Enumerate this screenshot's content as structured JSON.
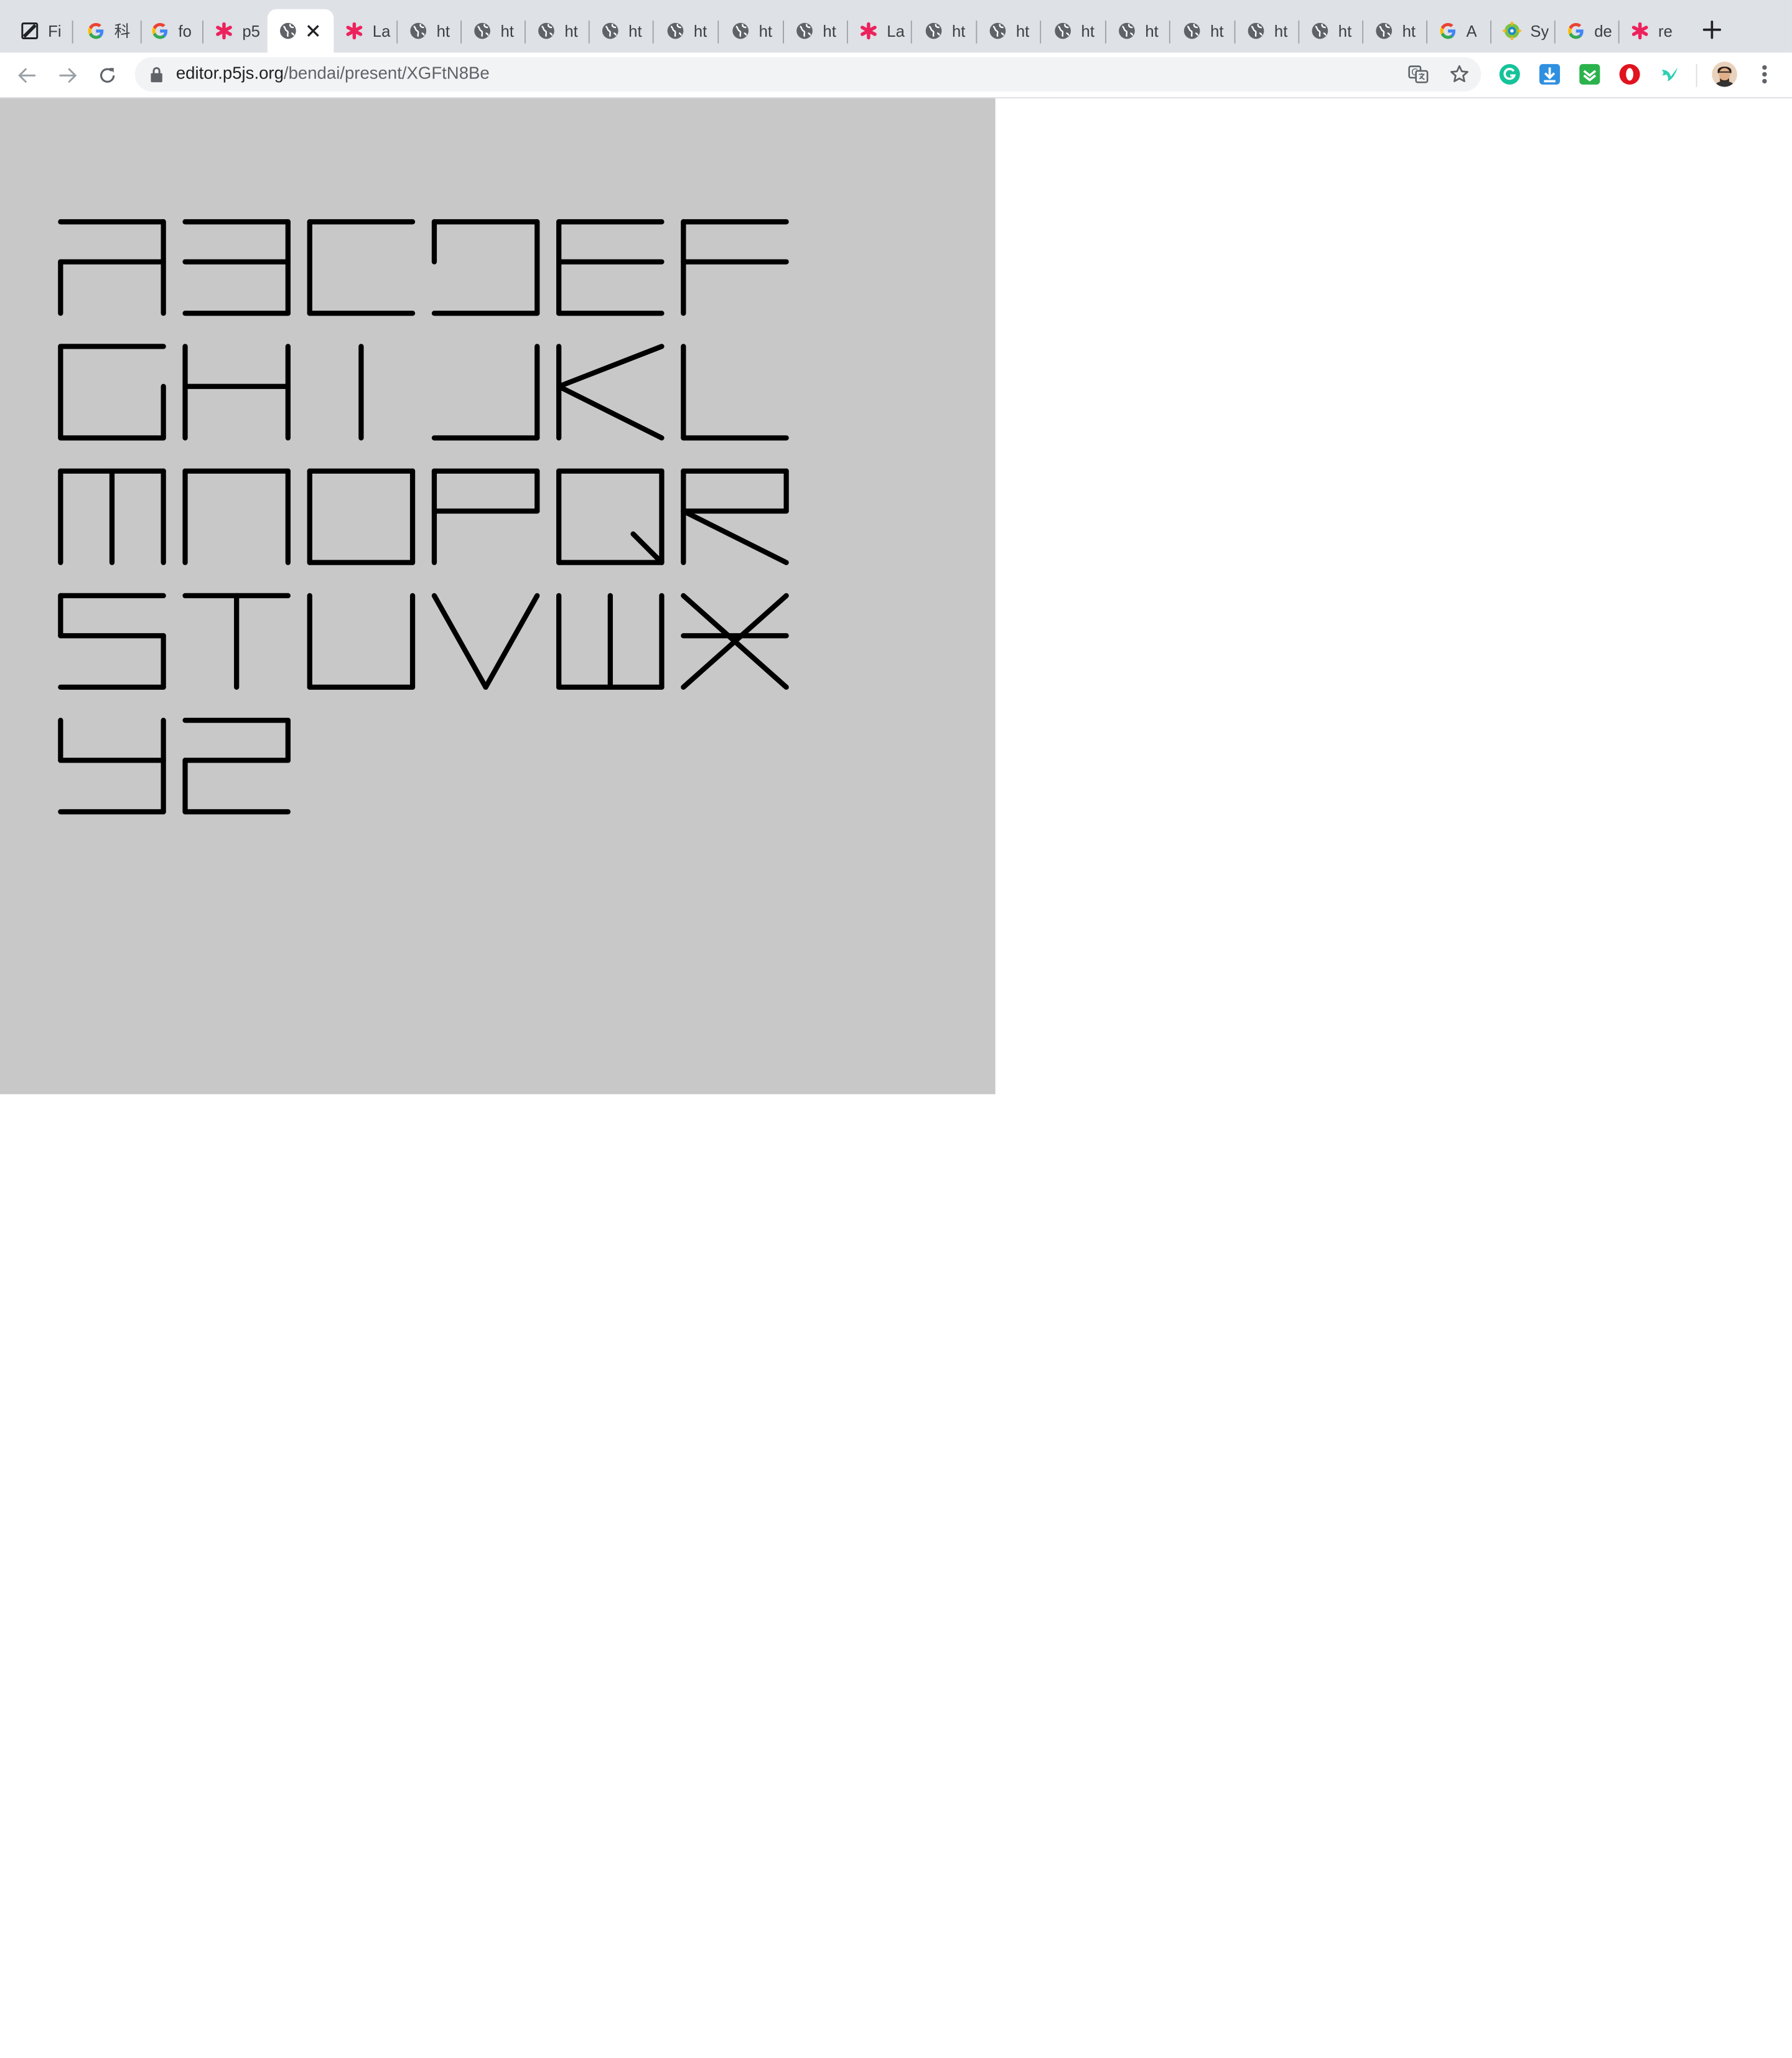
{
  "browser": {
    "tabs": [
      {
        "title": "Fi",
        "icon": "figma-icon"
      },
      {
        "title": "科",
        "icon": "google-icon"
      },
      {
        "title": "fo",
        "icon": "google-icon"
      },
      {
        "title": "p5",
        "icon": "p5-asterisk-icon"
      },
      {
        "title": "",
        "icon": "globe-icon",
        "active": true
      },
      {
        "title": "La",
        "icon": "p5-asterisk-icon"
      },
      {
        "title": "ht",
        "icon": "globe-icon"
      },
      {
        "title": "ht",
        "icon": "globe-icon"
      },
      {
        "title": "ht",
        "icon": "globe-icon"
      },
      {
        "title": "ht",
        "icon": "globe-icon"
      },
      {
        "title": "ht",
        "icon": "globe-icon"
      },
      {
        "title": "ht",
        "icon": "globe-icon"
      },
      {
        "title": "ht",
        "icon": "globe-icon"
      },
      {
        "title": "La",
        "icon": "p5-asterisk-icon"
      },
      {
        "title": "ht",
        "icon": "globe-icon"
      },
      {
        "title": "ht",
        "icon": "globe-icon"
      },
      {
        "title": "ht",
        "icon": "globe-icon"
      },
      {
        "title": "ht",
        "icon": "globe-icon"
      },
      {
        "title": "ht",
        "icon": "globe-icon"
      },
      {
        "title": "ht",
        "icon": "globe-icon"
      },
      {
        "title": "ht",
        "icon": "globe-icon"
      },
      {
        "title": "ht",
        "icon": "globe-icon"
      },
      {
        "title": "A",
        "icon": "google-icon"
      },
      {
        "title": "Sy",
        "icon": "gear-colorful-icon"
      },
      {
        "title": "de",
        "icon": "google-icon"
      },
      {
        "title": "re",
        "icon": "p5-asterisk-icon"
      }
    ],
    "address_bar": {
      "host": "editor.p5js.org",
      "path": "/bendai/present/XGFtN8Be"
    },
    "extensions": [
      "grammarly-icon",
      "download-icon",
      "feedly-icon",
      "opera-icon",
      "bird-icon"
    ],
    "colors": {
      "tabstrip": "#dee1e6",
      "p5_pink": "#ed225d"
    }
  },
  "sketch": {
    "background": "#c8c8c8",
    "stroke": "#000000",
    "letters": [
      "A",
      "B",
      "C",
      "D",
      "E",
      "F",
      "G",
      "H",
      "I",
      "J",
      "K",
      "L",
      "M",
      "N",
      "O",
      "P",
      "Q",
      "R",
      "S",
      "T",
      "U",
      "V",
      "W",
      "X",
      "Y",
      "Z"
    ]
  }
}
